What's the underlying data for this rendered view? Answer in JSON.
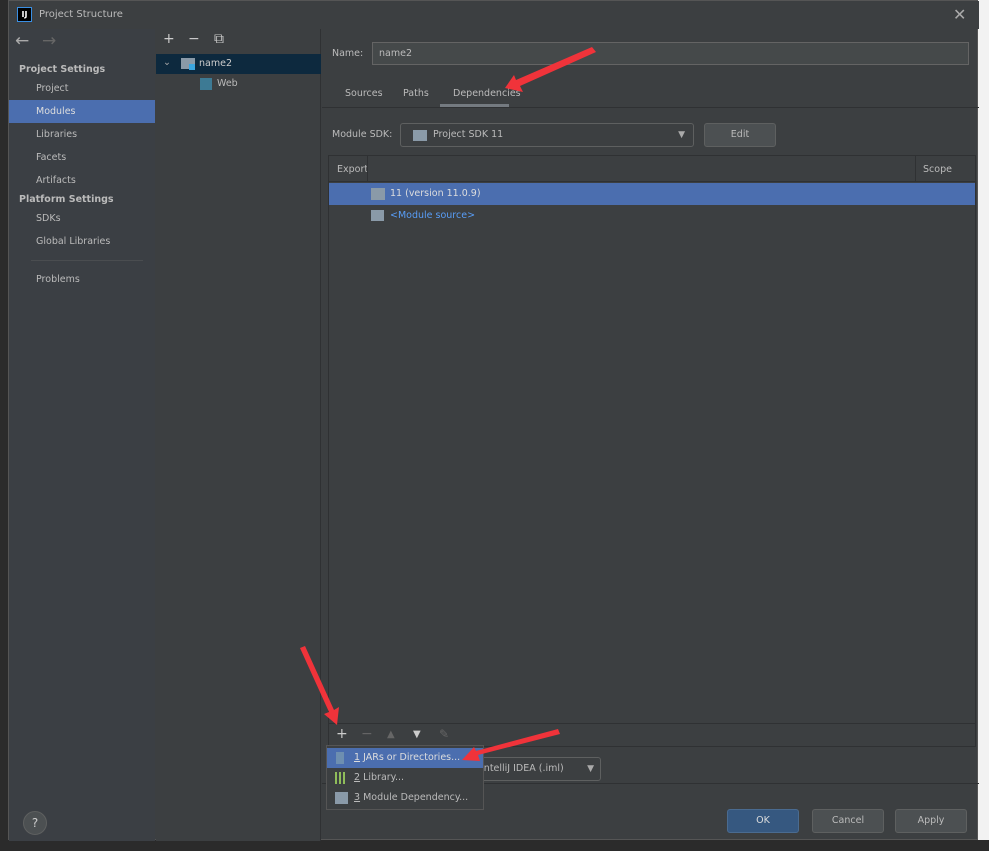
{
  "window": {
    "title": "Project Structure",
    "logo": "IJ",
    "close": "✕"
  },
  "sidebar": {
    "back": "←",
    "forward": "→",
    "project_settings": "Project Settings",
    "platform_settings": "Platform Settings",
    "items": [
      {
        "label": "Project"
      },
      {
        "label": "Modules"
      },
      {
        "label": "Libraries"
      },
      {
        "label": "Facets"
      },
      {
        "label": "Artifacts"
      }
    ],
    "platform_items": [
      {
        "label": "SDKs"
      },
      {
        "label": "Global Libraries"
      }
    ],
    "problems": "Problems"
  },
  "tree": {
    "add": "+",
    "remove": "−",
    "copy": "⧉",
    "nodes": [
      {
        "label": "name2"
      },
      {
        "label": "Web"
      }
    ]
  },
  "main": {
    "name_label": "Name:",
    "name_value": "name2",
    "tabs": [
      {
        "label": "Sources"
      },
      {
        "label": "Paths"
      },
      {
        "label": "Dependencies"
      }
    ],
    "sdk_label": "Module SDK:",
    "sdk_value": "Project SDK 11",
    "edit": "Edit",
    "table": {
      "headers": [
        "Export",
        "",
        "Scope"
      ],
      "rows": [
        {
          "label": "11 (version 11.0.9)"
        },
        {
          "label": "<Module source>"
        }
      ]
    },
    "format_value": "IntelliJ IDEA (.iml)"
  },
  "menu": {
    "items": [
      {
        "num": "1",
        "label": "JARs or Directories..."
      },
      {
        "num": "2",
        "label": "Library..."
      },
      {
        "num": "3",
        "label": "Module Dependency..."
      }
    ]
  },
  "footer": {
    "help": "?",
    "ok": "OK",
    "cancel": "Cancel",
    "apply": "Apply"
  },
  "colors": {
    "selection": "#4b6eaf",
    "link": "#589df6",
    "arrow": "#f0333a"
  }
}
